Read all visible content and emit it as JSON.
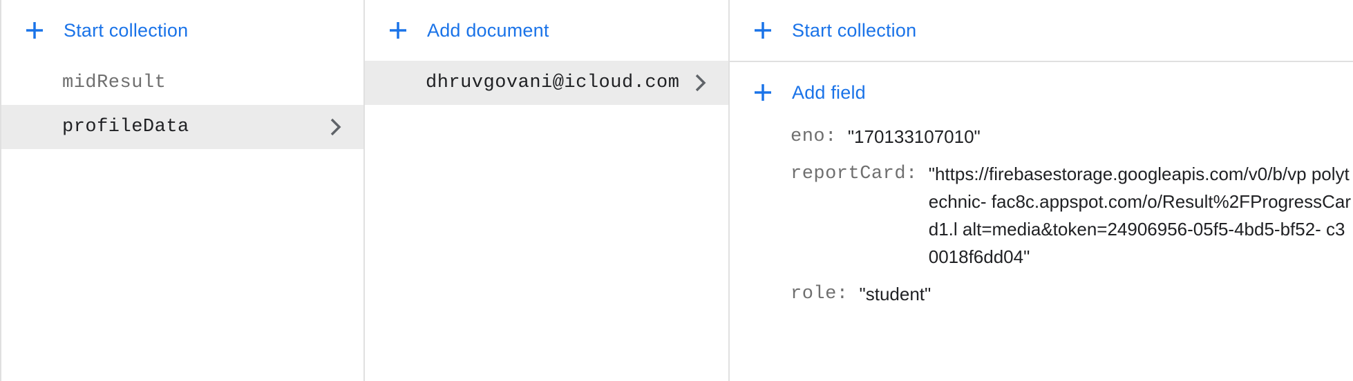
{
  "colors": {
    "accent": "#1a73e8",
    "selected_bg": "#ebebeb",
    "divider": "#e0e0e0",
    "muted_text": "#6f6f6f"
  },
  "collections_panel": {
    "action_label": "Start collection",
    "action_icon": "plus-icon",
    "items": [
      {
        "label": "midResult",
        "selected": false
      },
      {
        "label": "profileData",
        "selected": true
      }
    ]
  },
  "documents_panel": {
    "action_label": "Add document",
    "action_icon": "plus-icon",
    "items": [
      {
        "label": "dhruvgovani@icloud.com",
        "selected": true
      }
    ]
  },
  "document_panel": {
    "start_collection_label": "Start collection",
    "add_field_label": "Add field",
    "fields": [
      {
        "key": "eno:",
        "value": "\"170133107010\""
      },
      {
        "key": "reportCard:",
        "value": "\"https://firebasestorage.googleapis.com/v0/b/vp polytechnic- fac8c.appspot.com/o/Result%2FProgressCard1.l alt=media&token=24906956-05f5-4bd5-bf52- c30018f6dd04\""
      },
      {
        "key": "role:",
        "value": "\"student\""
      }
    ]
  }
}
